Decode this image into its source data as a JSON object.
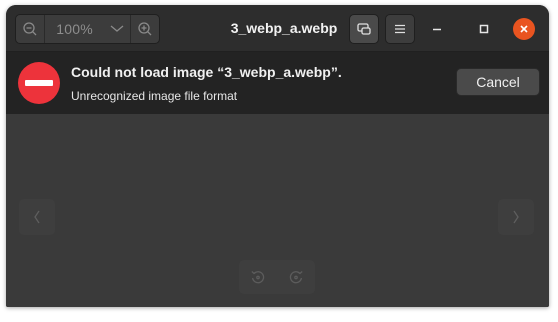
{
  "window": {
    "title": "3_webp_a.webp"
  },
  "toolbar": {
    "zoom_level": "100%",
    "zoom_out_icon": "zoom-out-icon",
    "zoom_in_icon": "zoom-in-icon",
    "zoom_menu_icon": "chevron-down-icon",
    "fullscreen_icon": "fullscreen-icon",
    "menu_icon": "hamburger-menu-icon"
  },
  "window_controls": {
    "minimize_icon": "minimize-icon",
    "maximize_icon": "maximize-icon",
    "close_icon": "close-icon",
    "close_color": "#e95420"
  },
  "infobar": {
    "title": "Could not load image “3_webp_a.webp”.",
    "detail": "Unrecognized image file format",
    "cancel_label": "Cancel",
    "icon": "error-icon",
    "icon_color": "#ed333b"
  },
  "overlay": {
    "prev_icon": "chevron-left-icon",
    "next_icon": "chevron-right-icon",
    "rotate_left_icon": "rotate-left-icon",
    "rotate_right_icon": "rotate-right-icon"
  }
}
